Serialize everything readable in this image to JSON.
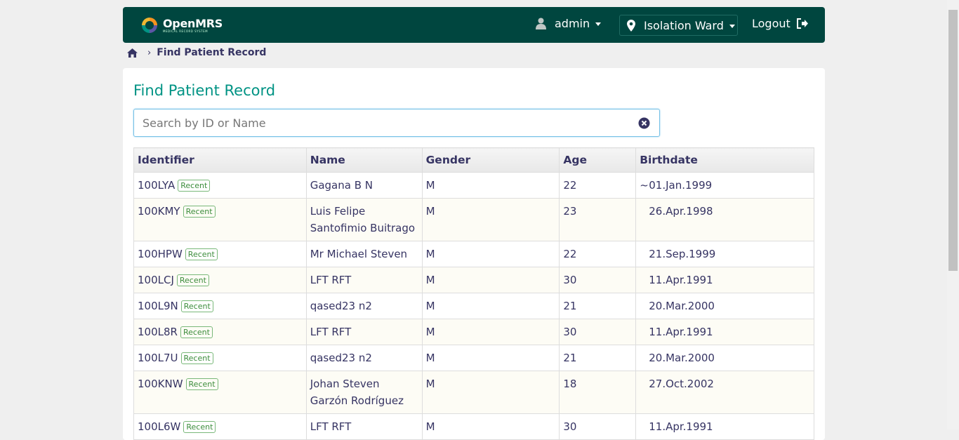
{
  "header": {
    "logo_text": "OpenMRS",
    "logo_subtext": "MEDICAL RECORD SYSTEM",
    "user_label": "admin",
    "location_label": "Isolation Ward",
    "logout_label": "Logout"
  },
  "breadcrumb": {
    "home_icon": "home-icon",
    "current": "Find Patient Record"
  },
  "page": {
    "title": "Find Patient Record",
    "search_placeholder": "Search by ID or Name",
    "search_value": ""
  },
  "table": {
    "headers": [
      "Identifier",
      "Name",
      "Gender",
      "Age",
      "Birthdate"
    ],
    "badge_label": "Recent",
    "rows": [
      {
        "id": "100LYA",
        "name_line1": "Gagana B N",
        "name_line2": "",
        "gender": "M",
        "age": "22",
        "estimated": "~",
        "birthdate": "01.Jan.1999"
      },
      {
        "id": "100KMY",
        "name_line1": "Luis Felipe",
        "name_line2": "Santofimio Buitrago",
        "gender": "M",
        "age": "23",
        "estimated": "",
        "birthdate": "26.Apr.1998"
      },
      {
        "id": "100HPW",
        "name_line1": "Mr Michael Steven",
        "name_line2": "",
        "gender": "M",
        "age": "22",
        "estimated": "",
        "birthdate": "21.Sep.1999"
      },
      {
        "id": "100LCJ",
        "name_line1": "LFT RFT",
        "name_line2": "",
        "gender": "M",
        "age": "30",
        "estimated": "",
        "birthdate": "11.Apr.1991"
      },
      {
        "id": "100L9N",
        "name_line1": "qased23 n2",
        "name_line2": "",
        "gender": "M",
        "age": "21",
        "estimated": "",
        "birthdate": "20.Mar.2000"
      },
      {
        "id": "100L8R",
        "name_line1": "LFT RFT",
        "name_line2": "",
        "gender": "M",
        "age": "30",
        "estimated": "",
        "birthdate": "11.Apr.1991"
      },
      {
        "id": "100L7U",
        "name_line1": "qased23 n2",
        "name_line2": "",
        "gender": "M",
        "age": "21",
        "estimated": "",
        "birthdate": "20.Mar.2000"
      },
      {
        "id": "100KNW",
        "name_line1": "Johan Steven",
        "name_line2": "Garzón Rodríguez",
        "gender": "M",
        "age": "18",
        "estimated": "",
        "birthdate": "27.Oct.2002"
      },
      {
        "id": "100L6W",
        "name_line1": "LFT RFT",
        "name_line2": "",
        "gender": "M",
        "age": "30",
        "estimated": "",
        "birthdate": "11.Apr.1991"
      }
    ]
  },
  "colors": {
    "header_bg": "#00463f",
    "title": "#009384",
    "badge": "#3c8d3c"
  }
}
